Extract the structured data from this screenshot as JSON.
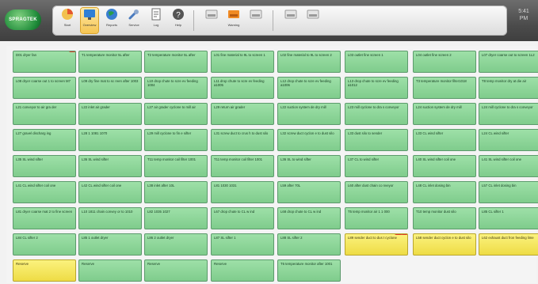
{
  "app": {
    "logo_text": "SPRAGTEK",
    "window_controls": "5:41\nPM"
  },
  "toolbar": {
    "items": [
      {
        "label": "Start",
        "icon": "pie-chart-icon",
        "color": "#e4572e",
        "active": false
      },
      {
        "label": "Overview",
        "icon": "monitor-icon",
        "color": "#2f7fd6",
        "active": true
      },
      {
        "label": "Reports",
        "icon": "globe-icon",
        "color": "#2a9d4a",
        "active": false
      },
      {
        "label": "Service",
        "icon": "wrench-icon",
        "color": "#4a7bbf",
        "active": false
      },
      {
        "label": "Log",
        "icon": "document-icon",
        "color": "#6c6c6c",
        "active": false
      },
      {
        "label": "Help",
        "icon": "help-icon",
        "color": "#555555",
        "active": false
      },
      {
        "label": "",
        "icon": "tray-icon",
        "color": "#9a9a9a",
        "active": false
      },
      {
        "label": "Warning",
        "icon": "alert-tray-icon",
        "color": "#f08a24",
        "active": false
      },
      {
        "label": "",
        "icon": "tray-icon",
        "color": "#9a9a9a",
        "active": false
      },
      {
        "label": "",
        "icon": "tray-icon",
        "color": "#9a9a9a",
        "active": false
      },
      {
        "label": "",
        "icon": "tray-icon",
        "color": "#9a9a9a",
        "active": false
      }
    ]
  },
  "grid": {
    "cells": [
      [
        "D01 dryer fan",
        "T1 temperature monitor 5L after",
        "T2 temperature monitor 5L after",
        "L01 fine material to 9L to screen 1",
        "L02 fine material to 9L to screen 2",
        "L03 outlet fine screen 1",
        "L04 outlet fine screen 2",
        "L07 dryer coarse out to screen 1L2"
      ],
      [
        "L08 dryer coarse out 1 to screen M7",
        "L09 dry fine mat to sc reen after 1003",
        "L10 drop chute to scre ev feeding 1004",
        "L11 drop chute to scre ev feeding a1005",
        "L12 drop chute to scre ev feeding a1006",
        "L13 drop chute to scre ev feeding a1012",
        "T3 temperature monitor filter1018",
        "T8 temp monitor dry at die air"
      ],
      [
        "L21 conveyor to air gra der",
        "L22 inlet air grader",
        "L27 air grader cyclone to mill air",
        "L29 return air grader",
        "L22 suction system de dry mill",
        "L23 mill cyclone to dra s conveyor",
        "L24 suction system de dry mill",
        "L24 mill cyclone to dra s conveyor"
      ],
      [
        "L27 gravel discharg ing",
        "L28 1 1081 1070",
        "L29 mill cyclone to fin e sifter",
        "L31 screw duct to crus h to dust silo",
        "L32 screw duct cyclon e to dust silo",
        "L33 dust silo to sender",
        "L33 CL wind sifter",
        "L24 CL wind sifter"
      ],
      [
        "L35 SL wind sifter",
        "L36 SL wind sifter",
        "T11 temp monitor coil filter 1001",
        "T11 temp monitor coil filter 1001",
        "L36 SL to wind sifter",
        "L37 CL to wind sifter",
        "L40 SL wind sifter coil one",
        "L41 SL wind sifter coil one"
      ],
      [
        "L41 CL wind sifter coil one",
        "L42 CL wind sifter coil one",
        "L38 inlet after 10L",
        "L81 1030 1031",
        "L59 after 70L",
        "L60 after dust chain co nveyor",
        "L48 CL inlet dosing bin",
        "L57 CL inlet dosing bin"
      ],
      [
        "L81 dryer coarse mat 2 to fine screen",
        "L10 1811 chain convey or to 1010",
        "L82 1035 1027",
        "L67 drop chute to CL w ind",
        "L68 drop chute to CL w ind",
        "T5 temp monitor air 1 1 000",
        "T10 temp monitor dust silo",
        "L85 CL sifter 1"
      ],
      [
        "L84 CL sifter 2",
        "L85 1 outlet dryer",
        "L86 2 outlet dryer",
        "L87 SL sifter 1",
        "L88 SL sifter 2",
        "L89 sender duct to dus t cyclone",
        "L58 sender duct cyclon e to dust silo",
        "L62 exhaust duct fron feeding lime"
      ],
      [
        "Reserve",
        "Reserve",
        "Reserve",
        "Reserve",
        "T6 temperature monitor after 1001"
      ]
    ]
  }
}
